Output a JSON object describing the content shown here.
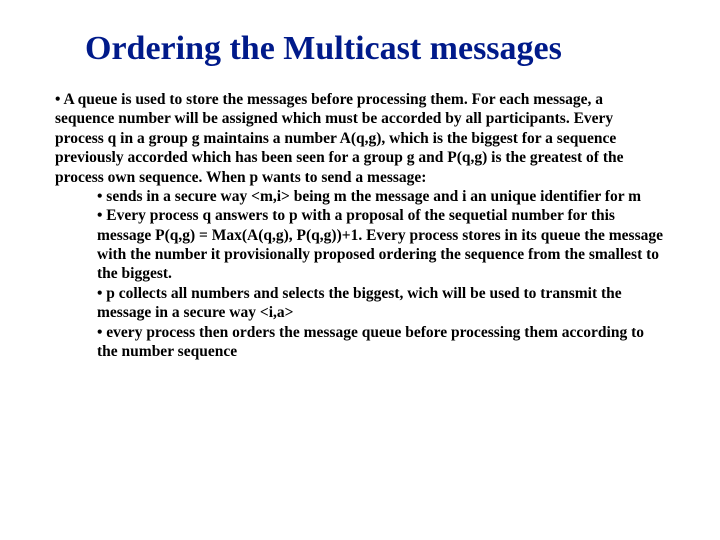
{
  "title": "Ordering the Multicast messages",
  "intro": "• A queue is used to store the messages before processing them. For each message, a sequence number will be assigned which must be accorded by all participants. Every process q in a group g maintains a number A(q,g), which is the biggest for a sequence previously accorded which has been seen for a group g and P(q,g) is the greatest of the process own sequence. When  p wants to send a message:",
  "bullets": [
    "• sends in a secure way <m,i> being m the message and i an unique identifier for m",
    "• Every  process q answers to p with a proposal of the sequetial number for this message P(q,g) = Max(A(q,g), P(q,g))+1. Every process stores in its queue the message with the number it provisionally proposed ordering the sequence from the smallest to the biggest.",
    "• p collects all numbers and selects the biggest, wich will be used to transmit the message in a secure way <i,a>",
    "• every process then orders the message queue before processing them according to the number sequence"
  ]
}
